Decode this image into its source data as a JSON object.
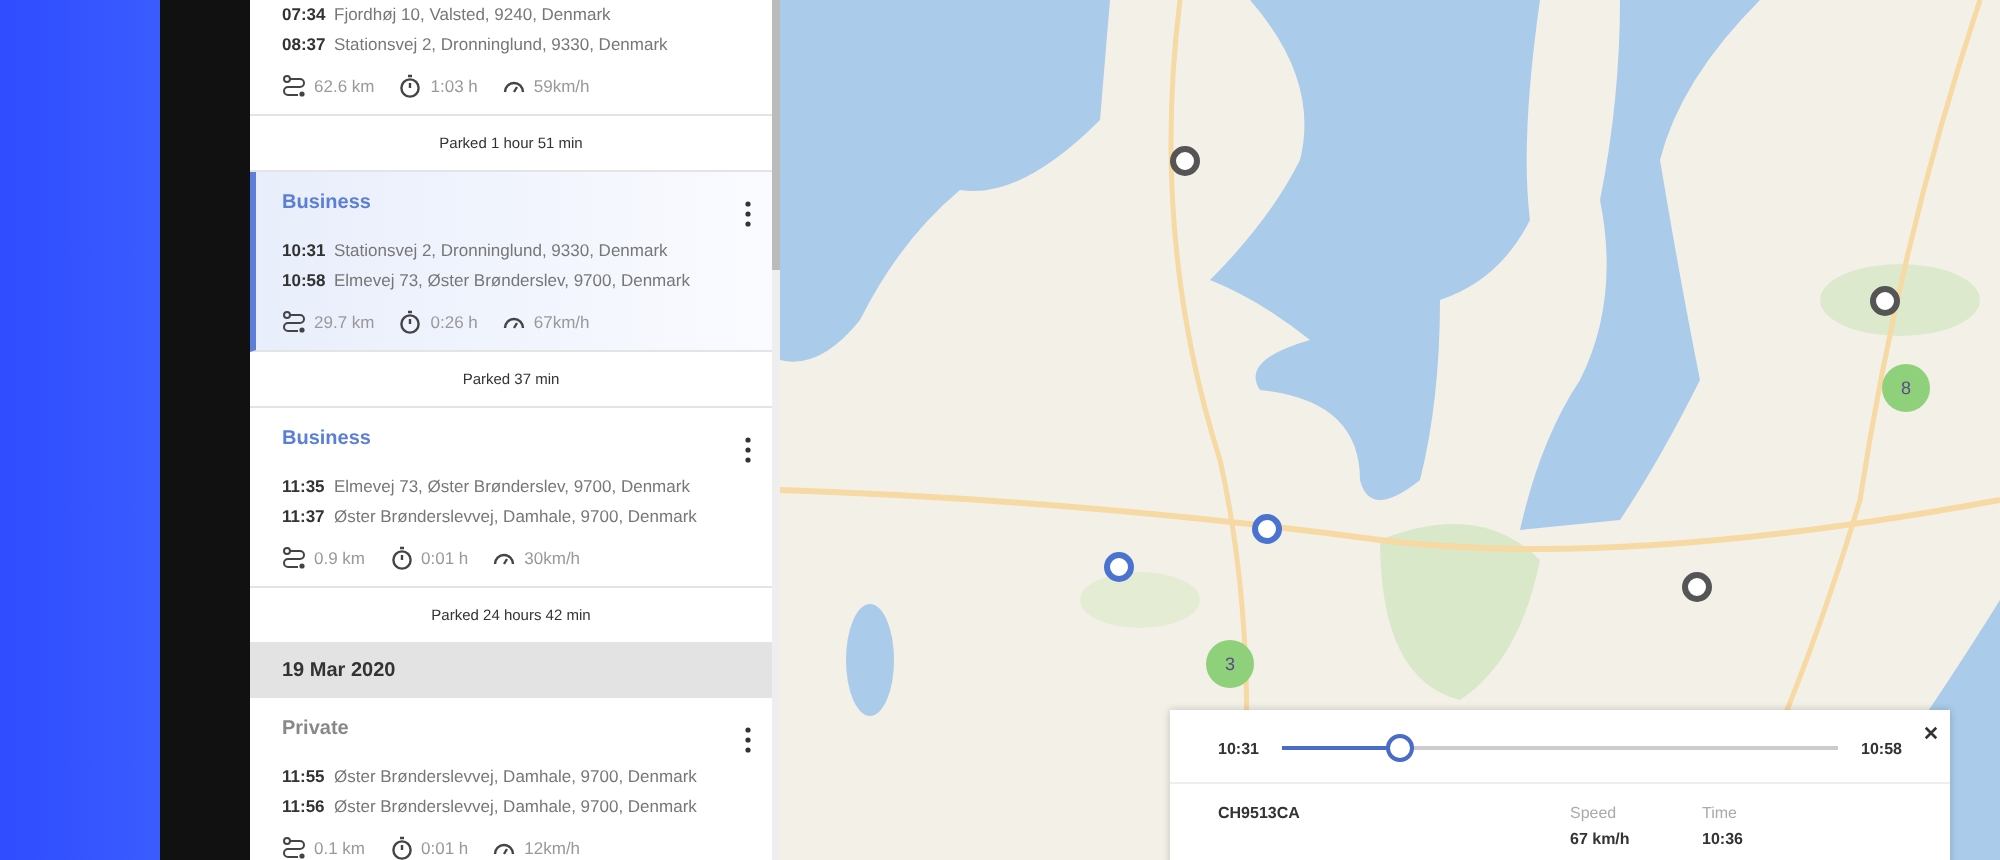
{
  "trip_list": [
    {
      "kind": "trip",
      "selected": false,
      "stops": [
        {
          "time": "07:34",
          "address": "Fjordhøj 10, Valsted, 9240, Denmark"
        },
        {
          "time": "08:37",
          "address": "Stationsvej 2, Dronninglund, 9330, Denmark"
        }
      ],
      "distance": "62.6 km",
      "duration": "1:03 h",
      "speed": "59km/h"
    },
    {
      "kind": "parked",
      "text": "Parked 1 hour 51 min"
    },
    {
      "kind": "trip",
      "selected": true,
      "category": "Business",
      "stops": [
        {
          "time": "10:31",
          "address": "Stationsvej 2, Dronninglund, 9330, Denmark"
        },
        {
          "time": "10:58",
          "address": "Elmevej 73, Øster Brønderslev, 9700, Denmark"
        }
      ],
      "distance": "29.7 km",
      "duration": "0:26 h",
      "speed": "67km/h"
    },
    {
      "kind": "parked",
      "text": "Parked 37 min"
    },
    {
      "kind": "trip",
      "selected": false,
      "category": "Business",
      "stops": [
        {
          "time": "11:35",
          "address": "Elmevej 73, Øster Brønderslev, 9700, Denmark"
        },
        {
          "time": "11:37",
          "address": "Øster Brønderslevvej, Damhale, 9700, Denmark"
        }
      ],
      "distance": "0.9 km",
      "duration": "0:01 h",
      "speed": "30km/h"
    },
    {
      "kind": "parked",
      "text": "Parked 24 hours 42 min"
    },
    {
      "kind": "date",
      "text": "19 Mar 2020"
    },
    {
      "kind": "trip",
      "selected": false,
      "category": "Private",
      "stops": [
        {
          "time": "11:55",
          "address": "Øster Brønderslevvej, Damhale, 9700, Denmark"
        },
        {
          "time": "11:56",
          "address": "Øster Brønderslevvej, Damhale, 9700, Denmark"
        }
      ],
      "distance": "0.1 km",
      "duration": "0:01 h",
      "speed": "12km/h"
    }
  ],
  "map": {
    "kind": "picture",
    "markers": [
      {
        "kind": "point",
        "color": "#555555"
      },
      {
        "kind": "point",
        "color": "#555555"
      },
      {
        "kind": "point",
        "color": "#555555"
      },
      {
        "kind": "point",
        "color": "#4a72d0"
      },
      {
        "kind": "point",
        "color": "#4a72d0"
      },
      {
        "kind": "cluster",
        "count": "3"
      },
      {
        "kind": "cluster",
        "count": "8"
      }
    ]
  },
  "playback_card": {
    "start_time": "10:31",
    "end_time": "10:58",
    "level": 0.21,
    "vehicle": "CH9513CA",
    "speed_label": "Speed",
    "speed": "67 km/h",
    "time_label": "Time",
    "time": "10:36"
  }
}
